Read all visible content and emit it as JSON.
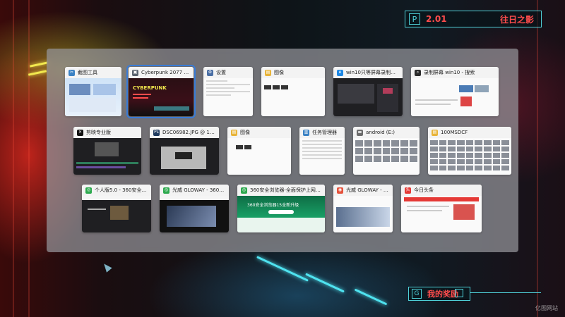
{
  "hud": {
    "top_badge": "P",
    "version": "2.01",
    "title": "往日之影",
    "bottom_badge": "G",
    "bottom_label": "我的奖励"
  },
  "watermark": "亿图网站",
  "taskview": {
    "rows": [
      [
        {
          "title": "截图工具",
          "icon": "snipping-tool-icon",
          "icon_color": "#3b82c4",
          "thumb": "blue"
        },
        {
          "title": "Cyberpunk 2077 (C) 2020...",
          "icon": "game-icon",
          "icon_color": "#5b6470",
          "thumb": "cyber",
          "selected": true
        },
        {
          "title": "设置",
          "icon": "gear-icon",
          "icon_color": "#4a6fa5",
          "thumb": "light"
        },
        {
          "title": "图像",
          "icon": "folder-icon",
          "icon_color": "#e8b43a",
          "thumb": "light"
        },
        {
          "title": "win10只等屏幕录制功能怎么...",
          "icon": "browser-icon",
          "icon_color": "#1e88e5",
          "thumb": "dark"
        },
        {
          "title": "录制屏幕 win10 - 搜索",
          "icon": "search-app-icon",
          "icon_color": "#2b2b2b",
          "thumb": "light"
        }
      ],
      [
        {
          "title": "剪映专业版",
          "icon": "capcut-icon",
          "icon_color": "#111111",
          "thumb": "dark"
        },
        {
          "title": "DSC06982.JPG @ 16.7%(RGB...",
          "icon": "photoshop-icon",
          "icon_color": "#1e3a5f",
          "thumb": "dark"
        },
        {
          "title": "图像",
          "icon": "folder-icon",
          "icon_color": "#e8b43a",
          "thumb": "light"
        },
        {
          "title": "任务管理器",
          "icon": "task-manager-icon",
          "icon_color": "#3b82c4",
          "thumb": "light"
        },
        {
          "title": "android (E:)",
          "icon": "drive-icon",
          "icon_color": "#6b6b6b",
          "thumb": "light"
        },
        {
          "title": "100MSDCF",
          "icon": "folder-icon",
          "icon_color": "#e8b43a",
          "thumb": "light"
        }
      ],
      [
        {
          "title": "个人版5.0 - 360安全浏览器 1...",
          "icon": "360-browser-icon",
          "icon_color": "#2eaa4f",
          "thumb": "dark"
        },
        {
          "title": "光威 GLOWAY - 360安全浏览...",
          "icon": "360-browser-icon",
          "icon_color": "#2eaa4f",
          "thumb": "black"
        },
        {
          "title": "360安全浏览器-全面保护上网安全, 4...",
          "icon": "360-browser-icon",
          "icon_color": "#2eaa4f",
          "thumb": "green"
        },
        {
          "title": "光威 GLOWAY - Googl...",
          "icon": "chrome-icon",
          "icon_color": "#e5533d",
          "thumb": "light"
        },
        {
          "title": "今日头条",
          "icon": "toutiao-icon",
          "icon_color": "#e53935",
          "thumb": "light"
        }
      ]
    ],
    "green_banner_text": "360安全浏览器15全新升级",
    "cyber_logo_text": "CYBERPUNK"
  }
}
